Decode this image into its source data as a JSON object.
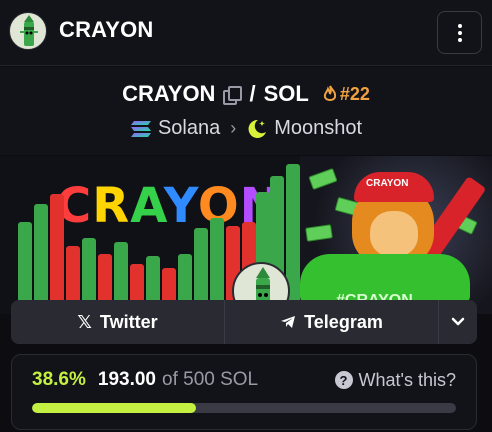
{
  "header": {
    "title": "CRAYON",
    "avatar_icon": "crayon-mascot-avatar",
    "menu_icon": "kebab-menu-icon"
  },
  "pair": {
    "base": "CRAYON",
    "separator": "/",
    "quote": "SOL",
    "rank": "#22",
    "rank_icon": "flame-icon",
    "chain": "Solana",
    "chain_icon": "solana-icon",
    "dex": "Moonshot",
    "dex_icon": "moonshot-icon"
  },
  "banner": {
    "title": "CRAYON",
    "hashtag": "#CRAYON",
    "cap_text": "CRAYON"
  },
  "links": {
    "twitter": "Twitter",
    "telegram": "Telegram"
  },
  "progress": {
    "percent": "38.6%",
    "amount": "193.00",
    "of_text": "of 500 SOL",
    "whats_this": "What's this?",
    "fill_fraction": 0.386
  },
  "colors": {
    "accent": "#c4f041",
    "rank": "#f2a341",
    "background": "#0c0c11"
  }
}
